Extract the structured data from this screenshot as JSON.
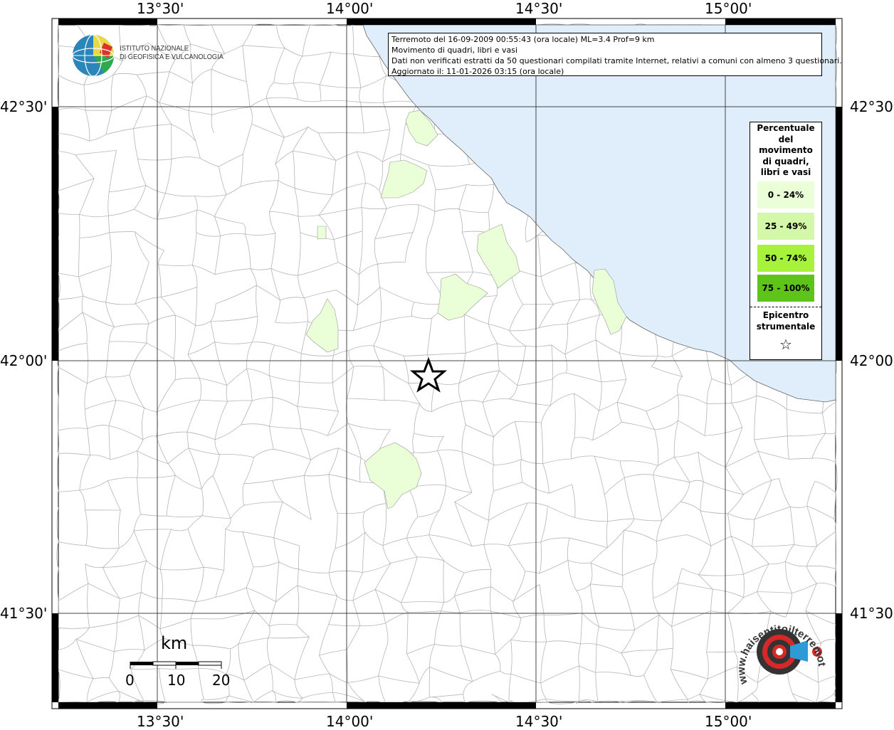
{
  "map": {
    "lon_labels": [
      "13°30'",
      "14°00'",
      "14°30'",
      "15°00'"
    ],
    "lat_labels": [
      "42°30'",
      "42°00'",
      "41°30'"
    ],
    "colors": {
      "sea": "#dfeefa",
      "class_0_24": "#eaffd8",
      "class_25_49": "#d2f8a8",
      "class_50_74": "#a7f23a",
      "class_75_100": "#5fc41a",
      "boundary": "#b5b5b5",
      "grid": "#444444"
    },
    "epicenter_icon": "star-icon"
  },
  "info": {
    "line1": "Terremoto del 16-09-2009 00:55:43 (ora locale) ML=3.4 Prof=9 km",
    "line2": "Movimento di quadri, libri e vasi",
    "line3": "Dati non verificati estratti da 50 questionari compilati tramite Internet, relativi a comuni con almeno 3 questionari.",
    "line4": "Aggiornato il: 11-01-2026 03:15 (ora locale)"
  },
  "legend": {
    "title_lines": [
      "Percentuale",
      "del",
      "movimento",
      "di quadri,",
      "libri e vasi"
    ],
    "classes": [
      {
        "label": "0 - 24%",
        "color": "#eaffd8"
      },
      {
        "label": "25 - 49%",
        "color": "#d2f8a8"
      },
      {
        "label": "50 - 74%",
        "color": "#a7f23a"
      },
      {
        "label": "75 - 100%",
        "color": "#5fc41a"
      }
    ],
    "epicenter_lines": [
      "Epicentro",
      "strumentale"
    ],
    "epicenter_symbol": "☆"
  },
  "logos": {
    "ingv_lines": [
      "ISTITUTO NAZIONALE",
      "DI GEOFISICA E VULCANOLOGIA"
    ],
    "hsit_text": "www.haisentitoilterremoto.it"
  },
  "scale": {
    "unit": "km",
    "labels": [
      "0",
      "10",
      "20"
    ]
  }
}
